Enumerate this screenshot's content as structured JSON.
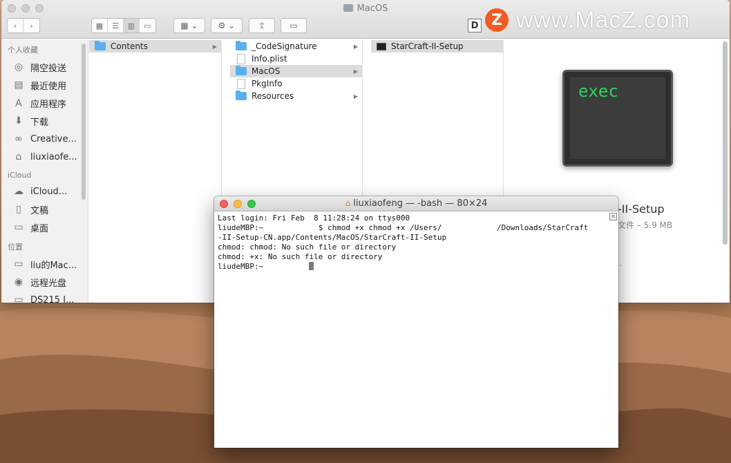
{
  "finder": {
    "title": "MacOS",
    "watermark": "www.MacZ.com",
    "watermark_logo": "Z",
    "d_button": "D",
    "toolbar_icons": [
      "back-icon",
      "forward-icon",
      "icon-view-icon",
      "list-view-icon",
      "column-view-icon",
      "gallery-view-icon",
      "arrange-icon",
      "action-gear-icon",
      "share-icon",
      "tag-icon"
    ]
  },
  "sidebar": {
    "favorites_header": "个人收藏",
    "favorites": [
      {
        "label": "隔空投送",
        "icon": "airdrop-icon"
      },
      {
        "label": "最近使用",
        "icon": "recents-icon"
      },
      {
        "label": "应用程序",
        "icon": "applications-icon"
      },
      {
        "label": "下载",
        "icon": "downloads-icon"
      },
      {
        "label": "Creative...",
        "icon": "creative-cloud-icon"
      },
      {
        "label": "liuxiaofe...",
        "icon": "home-icon"
      }
    ],
    "icloud_header": "iCloud",
    "icloud": [
      {
        "label": "iCloud...",
        "icon": "icloud-icon"
      },
      {
        "label": "文稿",
        "icon": "documents-icon"
      },
      {
        "label": "桌面",
        "icon": "desktop-icon"
      }
    ],
    "locations_header": "位置",
    "locations": [
      {
        "label": "liu的Mac...",
        "icon": "laptop-icon"
      },
      {
        "label": "远程光盘",
        "icon": "remote-disc-icon"
      },
      {
        "label": "DS215 I...",
        "icon": "server-icon"
      }
    ]
  },
  "columns": {
    "col1": [
      {
        "label": "Contents",
        "type": "folder",
        "selected": true,
        "arrow": "▶"
      }
    ],
    "col2": [
      {
        "label": "_CodeSignature",
        "type": "folder",
        "arrow": "▶"
      },
      {
        "label": "Info.plist",
        "type": "file"
      },
      {
        "label": "MacOS",
        "type": "folder",
        "selected": true,
        "arrow": "▶"
      },
      {
        "label": "PkgInfo",
        "type": "file"
      },
      {
        "label": "Resources",
        "type": "folder",
        "arrow": "▶"
      }
    ],
    "col3": [
      {
        "label": "StarCraft-II-Setup",
        "type": "exec",
        "selected": true
      }
    ]
  },
  "preview": {
    "icon_text": "exec",
    "name": "-II-Setup",
    "meta": "文件 – 5.9 MB",
    "more": "s..."
  },
  "terminal": {
    "title": "liuxiaofeng — -bash — 80×24",
    "lines": [
      "Last login: Fri Feb  8 11:28:24 on ttys000",
      "liudeMBP:~            $ chmod +x chmod +x /Users/            /Downloads/StarCraft",
      "-II-Setup-CN.app/Contents/MacOS/StarCraft-II-Setup",
      "chmod: chmod: No such file or directory",
      "chmod: +x: No such file or directory"
    ],
    "prompt": "liudeMBP:~          "
  }
}
